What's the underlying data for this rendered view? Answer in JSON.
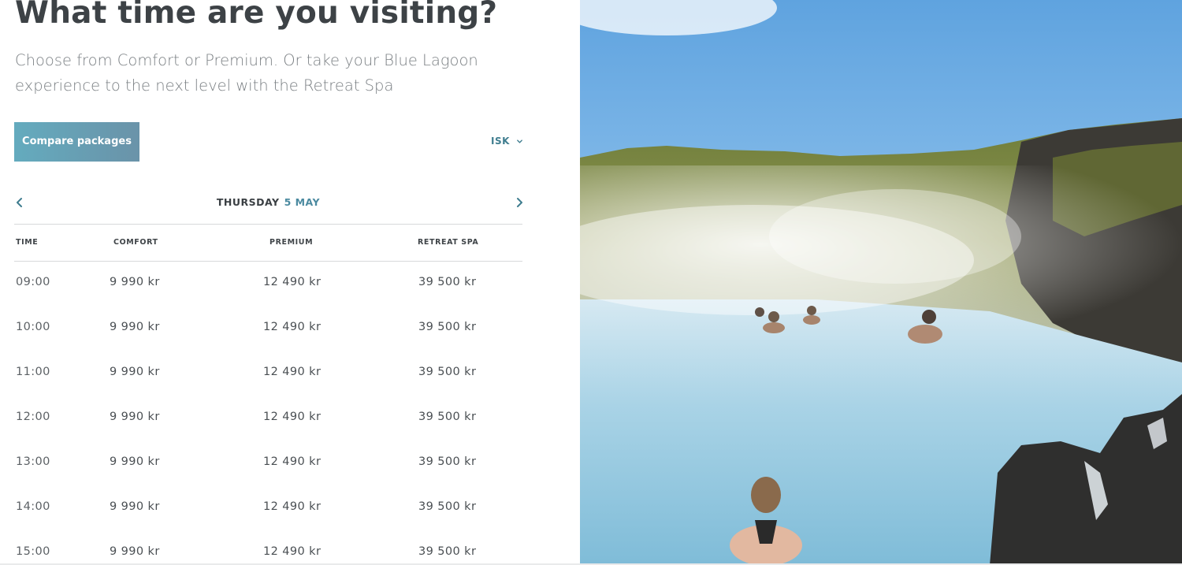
{
  "header": {
    "title": "What time are you visiting?",
    "subtitle": "Choose from Comfort or Premium. Or take your Blue Lagoon experience to the next level with the Retreat Spa"
  },
  "actions": {
    "compare_label": "Compare packages",
    "currency": "ISK"
  },
  "date_nav": {
    "day": "THURSDAY",
    "date": "5 MAY"
  },
  "table": {
    "headers": [
      "TIME",
      "COMFORT",
      "PREMIUM",
      "RETREAT SPA"
    ],
    "rows": [
      {
        "time": "09:00",
        "comfort": "9 990 kr",
        "premium": "12 490 kr",
        "retreat": "39 500 kr"
      },
      {
        "time": "10:00",
        "comfort": "9 990 kr",
        "premium": "12 490 kr",
        "retreat": "39 500 kr"
      },
      {
        "time": "11:00",
        "comfort": "9 990 kr",
        "premium": "12 490 kr",
        "retreat": "39 500 kr"
      },
      {
        "time": "12:00",
        "comfort": "9 990 kr",
        "premium": "12 490 kr",
        "retreat": "39 500 kr"
      },
      {
        "time": "13:00",
        "comfort": "9 990 kr",
        "premium": "12 490 kr",
        "retreat": "39 500 kr"
      },
      {
        "time": "14:00",
        "comfort": "9 990 kr",
        "premium": "12 490 kr",
        "retreat": "39 500 kr"
      },
      {
        "time": "15:00",
        "comfort": "9 990 kr",
        "premium": "12 490 kr",
        "retreat": "39 500 kr"
      }
    ]
  },
  "icons": {
    "prev": "chevron-left-icon",
    "next": "chevron-right-icon",
    "currency_dropdown": "chevron-down-icon"
  },
  "colors": {
    "accent": "#4b8aa0",
    "button_gradient_start": "#64abbe",
    "button_gradient_end": "#6a93a9",
    "heading": "#3d4246",
    "divider": "#d7d9db"
  }
}
